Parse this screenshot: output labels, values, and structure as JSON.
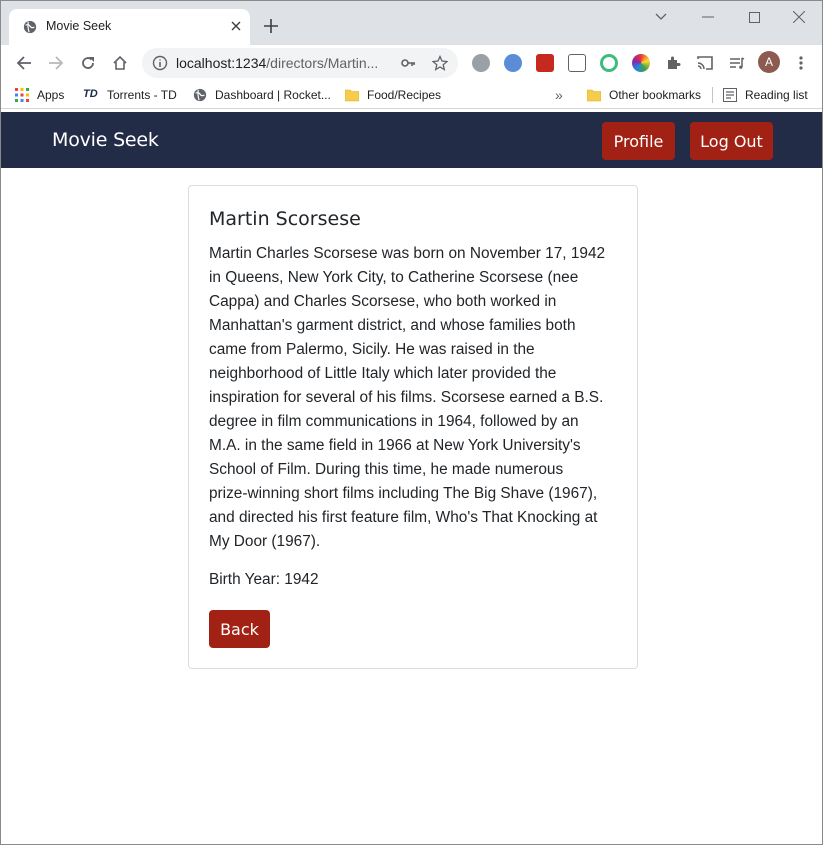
{
  "browser": {
    "tab_title": "Movie Seek",
    "url_host": "localhost:1234",
    "url_path": "/directors/Martin...",
    "avatar_letter": "A",
    "bookmarks": {
      "apps": "Apps",
      "torrents": "Torrents - TD",
      "torrents_badge": "TD",
      "dashboard": "Dashboard | Rocket...",
      "food": "Food/Recipes",
      "more": "»",
      "other": "Other bookmarks",
      "reading": "Reading list"
    }
  },
  "navbar": {
    "brand": "Movie Seek",
    "profile_label": "Profile",
    "logout_label": "Log Out"
  },
  "director": {
    "name": "Martin Scorsese",
    "bio_lines": [
      "Martin Charles Scorsese was born on November 17, 1942",
      "in Queens, New York City, to Catherine Scorsese (nee",
      "Cappa) and Charles Scorsese, who both worked in",
      "Manhattan's garment district, and whose families both",
      "came from Palermo, Sicily. He was raised in the",
      "neighborhood of Little Italy which later provided the",
      "inspiration for several of his films. Scorsese earned a B.S.",
      "degree in film communications in 1964, followed by an",
      "M.A. in the same field in 1966 at New York University's",
      "School of Film. During this time, he made numerous",
      "prize-winning short films including The Big Shave (1967),",
      "and directed his first feature film, Who's That Knocking at",
      "My Door (1967)."
    ],
    "birth_year_text": "Birth Year: 1942",
    "back_label": "Back"
  },
  "colors": {
    "navbar_bg": "#232c46",
    "accent_button": "#a12214"
  }
}
